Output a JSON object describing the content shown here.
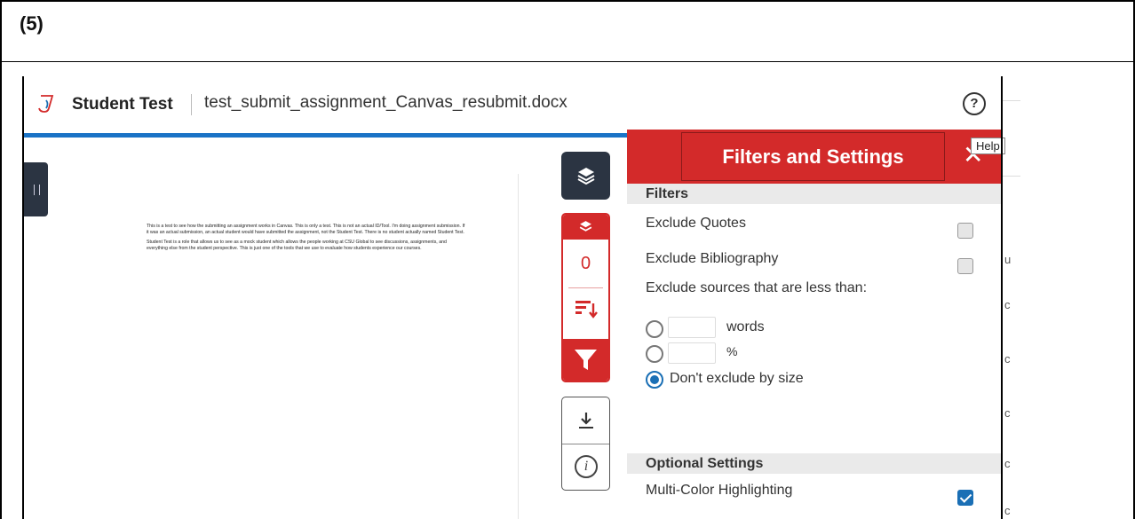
{
  "step_label": "(5)",
  "header": {
    "student_name": "Student Test",
    "filename": "test_submit_assignment_Canvas_resubmit.docx",
    "help_icon": "?"
  },
  "document": {
    "paragraphs": [
      "This is a test to see how the submitting an assignment works in Canvas. This is only a test. This is not an actual ID/Tool. I'm doing assignment submission. If it was an actual submission, an actual student would have submitted the assignment, not the Student Test. There is no student actually named Student Test.",
      "Student Test is a role that allows us to see as a mock student which allows the people working at CSU Global to see discussions, assignments, and everything else from the student perspective. This is just one of the tools that we use to evaluate how students experience our courses."
    ]
  },
  "rail": {
    "match_count": "0",
    "download_icon": "download-icon",
    "info_icon": "i"
  },
  "panel": {
    "title": "Filters and Settings",
    "close": "✕",
    "tooltip": "Help",
    "filters_title": "Filters",
    "exclude_quotes": "Exclude Quotes",
    "exclude_bibliography": "Exclude Bibliography",
    "exclude_less_than": "Exclude sources that are less than:",
    "words_unit": "words",
    "percent_unit": "%",
    "dont_exclude": "Don't exclude by size",
    "optional_title": "Optional Settings",
    "multicolor": "Multi-Color Highlighting",
    "state": {
      "exclude_quotes": false,
      "exclude_bibliography": false,
      "size_option": "dont_exclude",
      "multicolor": true
    }
  },
  "colors": {
    "accent_red": "#d32a2a",
    "nav_dark": "#2b3442",
    "progress_blue": "#1a73c6",
    "check_blue": "#1a6fb5"
  },
  "behind_chars": [
    "u",
    "c",
    "c",
    "c",
    "c",
    "c"
  ]
}
